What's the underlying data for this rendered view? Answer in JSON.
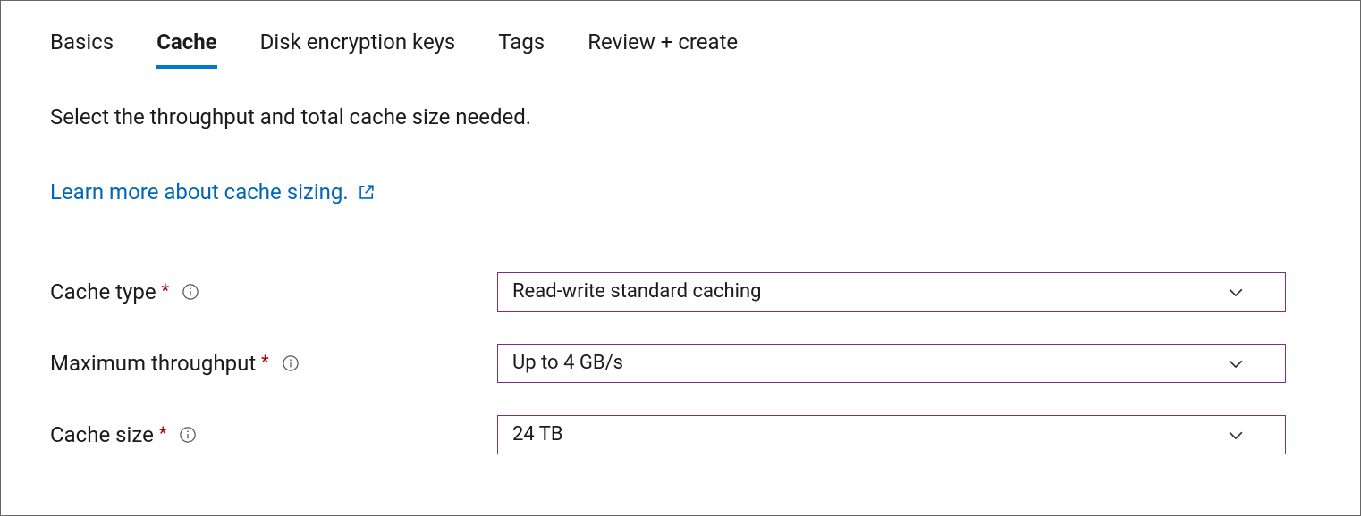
{
  "tabs": {
    "basics": "Basics",
    "cache": "Cache",
    "disk_keys": "Disk encryption keys",
    "tags": "Tags",
    "review": "Review + create"
  },
  "intro": "Select the throughput and total cache size needed.",
  "learn_link": "Learn more about cache sizing.",
  "form": {
    "cache_type": {
      "label": "Cache type",
      "value": "Read-write standard caching"
    },
    "max_throughput": {
      "label": "Maximum throughput",
      "value": "Up to 4 GB/s"
    },
    "cache_size": {
      "label": "Cache size",
      "value": "24 TB"
    }
  }
}
